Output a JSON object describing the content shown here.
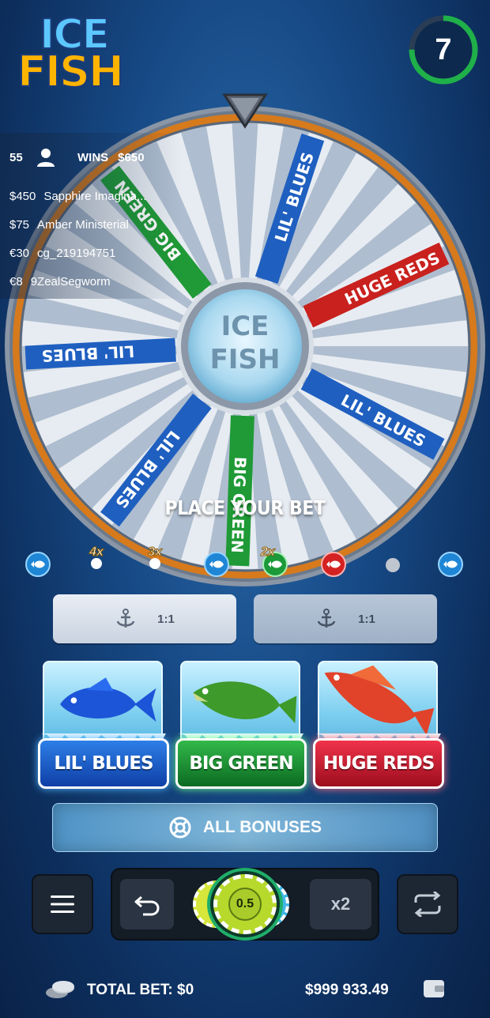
{
  "logo": {
    "line1": "ICE",
    "line2": "FISH"
  },
  "timer": {
    "value": "7",
    "progress": 0.75,
    "color": "#1fb04a"
  },
  "players": {
    "count": "55",
    "wins_label": "WINS",
    "wins_amount": "$650",
    "rows": [
      {
        "amount": "$450",
        "name": "Sapphire Imagina..."
      },
      {
        "amount": "$75",
        "name": "Amber Ministerial"
      },
      {
        "amount": "€30",
        "name": "cg_219194751"
      },
      {
        "amount": "€8",
        "name": "9ZealSegworm"
      }
    ]
  },
  "wheel": {
    "hub_line1": "ICE",
    "hub_line2": "FISH",
    "segment_labels": [
      "LIL' BLUES",
      "HUGE REDS",
      "LIL' BLUES",
      "BIG GREEN",
      "LIL' BLUES",
      "LIL' BLUES",
      "BIG GREEN"
    ]
  },
  "status": "PLACE YOUR BET",
  "history": [
    {
      "type": "blue",
      "icon": "fish-icon"
    },
    {
      "type": "mult",
      "label": "4x"
    },
    {
      "type": "mult",
      "label": "3x"
    },
    {
      "type": "blue",
      "icon": "fish-icon"
    },
    {
      "type": "green",
      "label": "2x"
    },
    {
      "type": "red",
      "icon": "fish-icon"
    },
    {
      "type": "dot"
    },
    {
      "type": "blue",
      "icon": "fish-icon"
    }
  ],
  "bets": [
    {
      "icon": "anchor-icon",
      "odds": "1:1"
    },
    {
      "icon": "anchor-icon",
      "odds": "1:1"
    }
  ],
  "fish": [
    {
      "label": "LIL' BLUES",
      "color": "#1f6fe0"
    },
    {
      "label": "BIG GREEN",
      "color": "#22a33c"
    },
    {
      "label": "HUGE REDS",
      "color": "#e32a40"
    }
  ],
  "bonuses_label": "ALL BONUSES",
  "controls": {
    "chip_value": "0.5",
    "double_label": "x2"
  },
  "footer": {
    "total_bet": "TOTAL BET: $0",
    "balance": "$999 933.49"
  }
}
